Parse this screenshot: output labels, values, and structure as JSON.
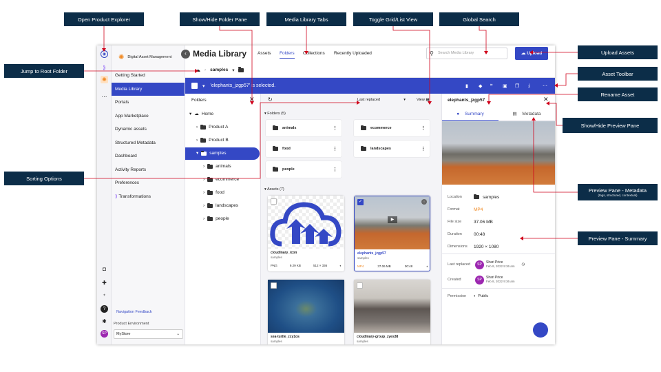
{
  "callouts": {
    "product_explorer": "Open Product Explorer",
    "folder_pane": "Show/Hide Folder Pane",
    "library_tabs": "Media Library Tabs",
    "toggle_view": "Toggle Grid/List View",
    "global_search": "Global  Search",
    "upload_assets": "Upload Assets",
    "root_folder": "Jump to Root Folder",
    "asset_toolbar": "Asset Toolbar",
    "rename_asset": "Rename Asset",
    "preview_toggle": "Show/Hide Preview Pane",
    "sorting": "Sorting Options",
    "preview_metadata": "Preview Pane - Metadata",
    "preview_metadata_sub": "(tags, structured, contextual)",
    "preview_summary": "Preview Pane - Summary"
  },
  "nav": {
    "brand": "Digital Asset Management",
    "items": [
      "Getting Started",
      "Media Library",
      "Portals",
      "App Marketplace",
      "Dynamic assets",
      "Structured Metadata",
      "Dashboard",
      "Activity Reports",
      "Preferences",
      "Transformations"
    ],
    "feedback": "Navigation Feedback",
    "env_label": "Product Environment",
    "env_value": "MyStore",
    "user_initials": "SP"
  },
  "header": {
    "title": "Media Library",
    "tabs": [
      "Assets",
      "Folders",
      "Collections",
      "Recently Uploaded"
    ],
    "search_placeholder": "Search Media Library",
    "upload_label": "Upload"
  },
  "breadcrumb": {
    "folder": "samples"
  },
  "selection": {
    "text": "'elephants_jzgp57' is selected."
  },
  "folders_pane": {
    "title": "Folders",
    "home": "Home",
    "items": [
      "Product A",
      "Product B",
      "samples"
    ],
    "subitems": [
      "animals",
      "ecommerce",
      "food",
      "landscapes",
      "people"
    ]
  },
  "grid": {
    "sort_label": "Last replaced",
    "view_label": "View",
    "folders_heading": "Folders (5)",
    "folders": [
      "animals",
      "ecommerce",
      "food",
      "landscapes",
      "people"
    ],
    "assets_heading": "Assets (7)",
    "assets": [
      {
        "name": "cloudinary_icon",
        "folder": "samples",
        "format": "PNG",
        "size": "9.29 KB",
        "dims": "512 × 336"
      },
      {
        "name": "elephants_jzgp57",
        "folder": "samples",
        "format": "MP4",
        "size": "37.06 MB",
        "duration": "00:48"
      },
      {
        "name": "sea-turtle_zcy1os",
        "folder": "samples"
      },
      {
        "name": "cloudinary-group_zyes38",
        "folder": "samples"
      }
    ]
  },
  "preview": {
    "title": "elephants_jzgp57",
    "tab_summary": "Summary",
    "tab_metadata": "Metadata",
    "rows": [
      {
        "k": "Location",
        "v": "samples"
      },
      {
        "k": "Format",
        "v": "MP4"
      },
      {
        "k": "File size",
        "v": "37.06 MB"
      },
      {
        "k": "Duration",
        "v": "00:48"
      },
      {
        "k": "Dimensions",
        "v": "1920 × 1080"
      }
    ],
    "replaced_label": "Last replaced",
    "replaced_name": "Shari Price",
    "replaced_date": "Feb 8, 2022 9:36 am",
    "created_label": "Created",
    "created_name": "Shari Price",
    "created_date": "Feb 8, 2022 9:36 am",
    "permission_label": "Permission",
    "permission_value": "Public"
  },
  "colors": {
    "accent": "#3448c5",
    "callout": "#0c2d48",
    "line": "#d0021b"
  }
}
